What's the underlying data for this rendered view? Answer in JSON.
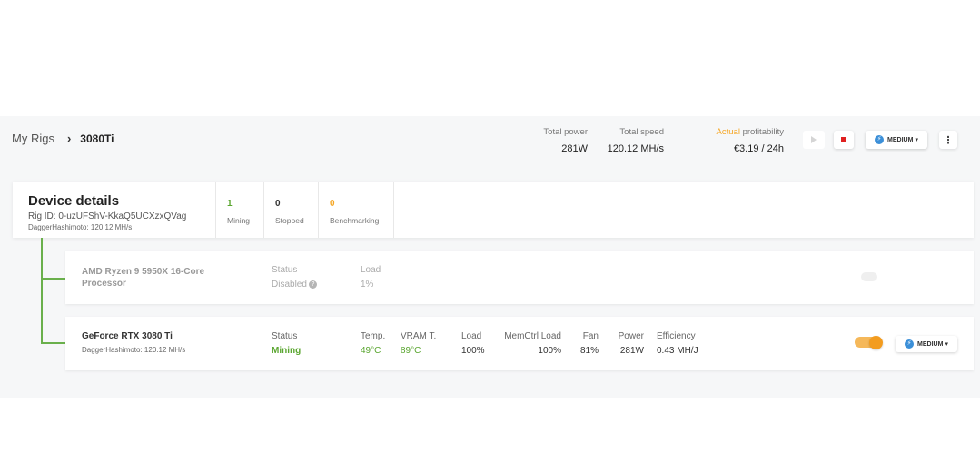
{
  "breadcrumb": {
    "root": "My Rigs",
    "separator": "›",
    "current": "3080Ti"
  },
  "header": {
    "total_power": {
      "label": "Total power",
      "value": "281W"
    },
    "total_speed": {
      "label": "Total speed",
      "value": "120.12 MH/s"
    },
    "profitability": {
      "label_accent": "Actual",
      "label_rest": " profitability",
      "value": "€3.19 / 24h"
    },
    "mode_label": "MEDIUM",
    "more_glyph": "⋮"
  },
  "device_details": {
    "title": "Device details",
    "rig_id": "Rig ID: 0-uzUFShV-KkaQ5UCXzxQVag",
    "algo": "DaggerHashimoto: 120.12 MH/s",
    "counts": {
      "mining": {
        "value": "1",
        "label": "Mining"
      },
      "stopped": {
        "value": "0",
        "label": "Stopped"
      },
      "benchmarking": {
        "value": "0",
        "label": "Benchmarking"
      }
    }
  },
  "devices": [
    {
      "name": "AMD Ryzen 9 5950X 16-Core Processor",
      "status_label": "Status",
      "status_value": "Disabled",
      "help_glyph": "?",
      "load_label": "Load",
      "load_value": "1%"
    },
    {
      "name": "GeForce RTX 3080 Ti",
      "algo": "DaggerHashimoto: 120.12 MH/s",
      "status": {
        "label": "Status",
        "value": "Mining"
      },
      "temp": {
        "label": "Temp.",
        "value": "49°C"
      },
      "vram": {
        "label": "VRAM T.",
        "value": "89°C"
      },
      "load": {
        "label": "Load",
        "value": "100%"
      },
      "memctrl": {
        "label": "MemCtrl Load",
        "value": "100%"
      },
      "fan": {
        "label": "Fan",
        "value": "81%"
      },
      "power": {
        "label": "Power",
        "value": "281W"
      },
      "efficiency": {
        "label": "Efficiency",
        "value": "0.43 MH/J"
      },
      "enabled": true,
      "mode_label": "MEDIUM"
    }
  ],
  "icons": {
    "bolt": "lightning-icon",
    "chevron": "▾"
  },
  "colors": {
    "accent_orange": "#f5a623",
    "mining_green": "#5aa630",
    "stop_red": "#e02020",
    "bolt_blue": "#3b8fd8"
  }
}
